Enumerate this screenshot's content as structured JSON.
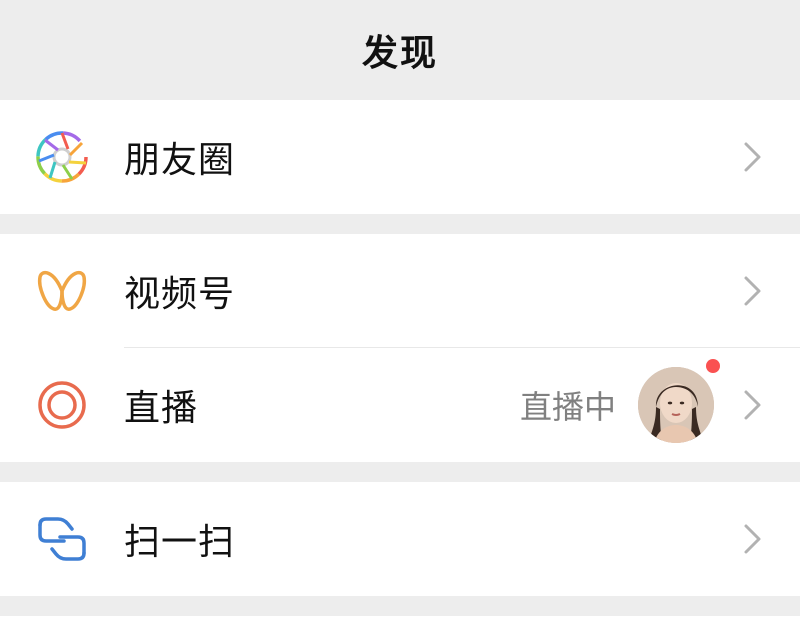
{
  "header": {
    "title": "发现"
  },
  "menu": {
    "moments": {
      "label": "朋友圈",
      "icon": "moments-aperture-icon"
    },
    "channels": {
      "label": "视频号",
      "icon": "channels-icon"
    },
    "live": {
      "label": "直播",
      "icon": "live-icon",
      "status": "直播中"
    },
    "scan": {
      "label": "扫一扫",
      "icon": "scan-icon"
    }
  },
  "colors": {
    "background": "#ededed",
    "surface": "#ffffff",
    "text_primary": "#111111",
    "text_secondary": "#808080",
    "chevron": "#b2b2b2",
    "channels_icon": "#f0a645",
    "live_icon": "#e86b4e",
    "scan_icon": "#3f7fd4",
    "live_badge": "#fa5151"
  }
}
